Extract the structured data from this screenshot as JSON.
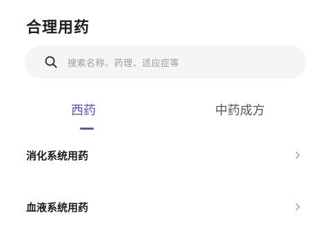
{
  "header": {
    "title": "合理用药"
  },
  "search": {
    "placeholder": "搜索名称、药理、适应症等",
    "icon": "search-icon"
  },
  "tabs": [
    {
      "label": "西药",
      "active": true
    },
    {
      "label": "中药成方",
      "active": false
    }
  ],
  "categories": [
    {
      "label": "消化系统用药",
      "icon": "chevron-right-icon"
    },
    {
      "label": "血液系统用药",
      "icon": "chevron-right-icon"
    }
  ],
  "colors": {
    "accent": "#5b4bd6",
    "search_bg": "#f4f5f7",
    "placeholder": "#9a9a9a",
    "inactive_tab": "#555555"
  }
}
